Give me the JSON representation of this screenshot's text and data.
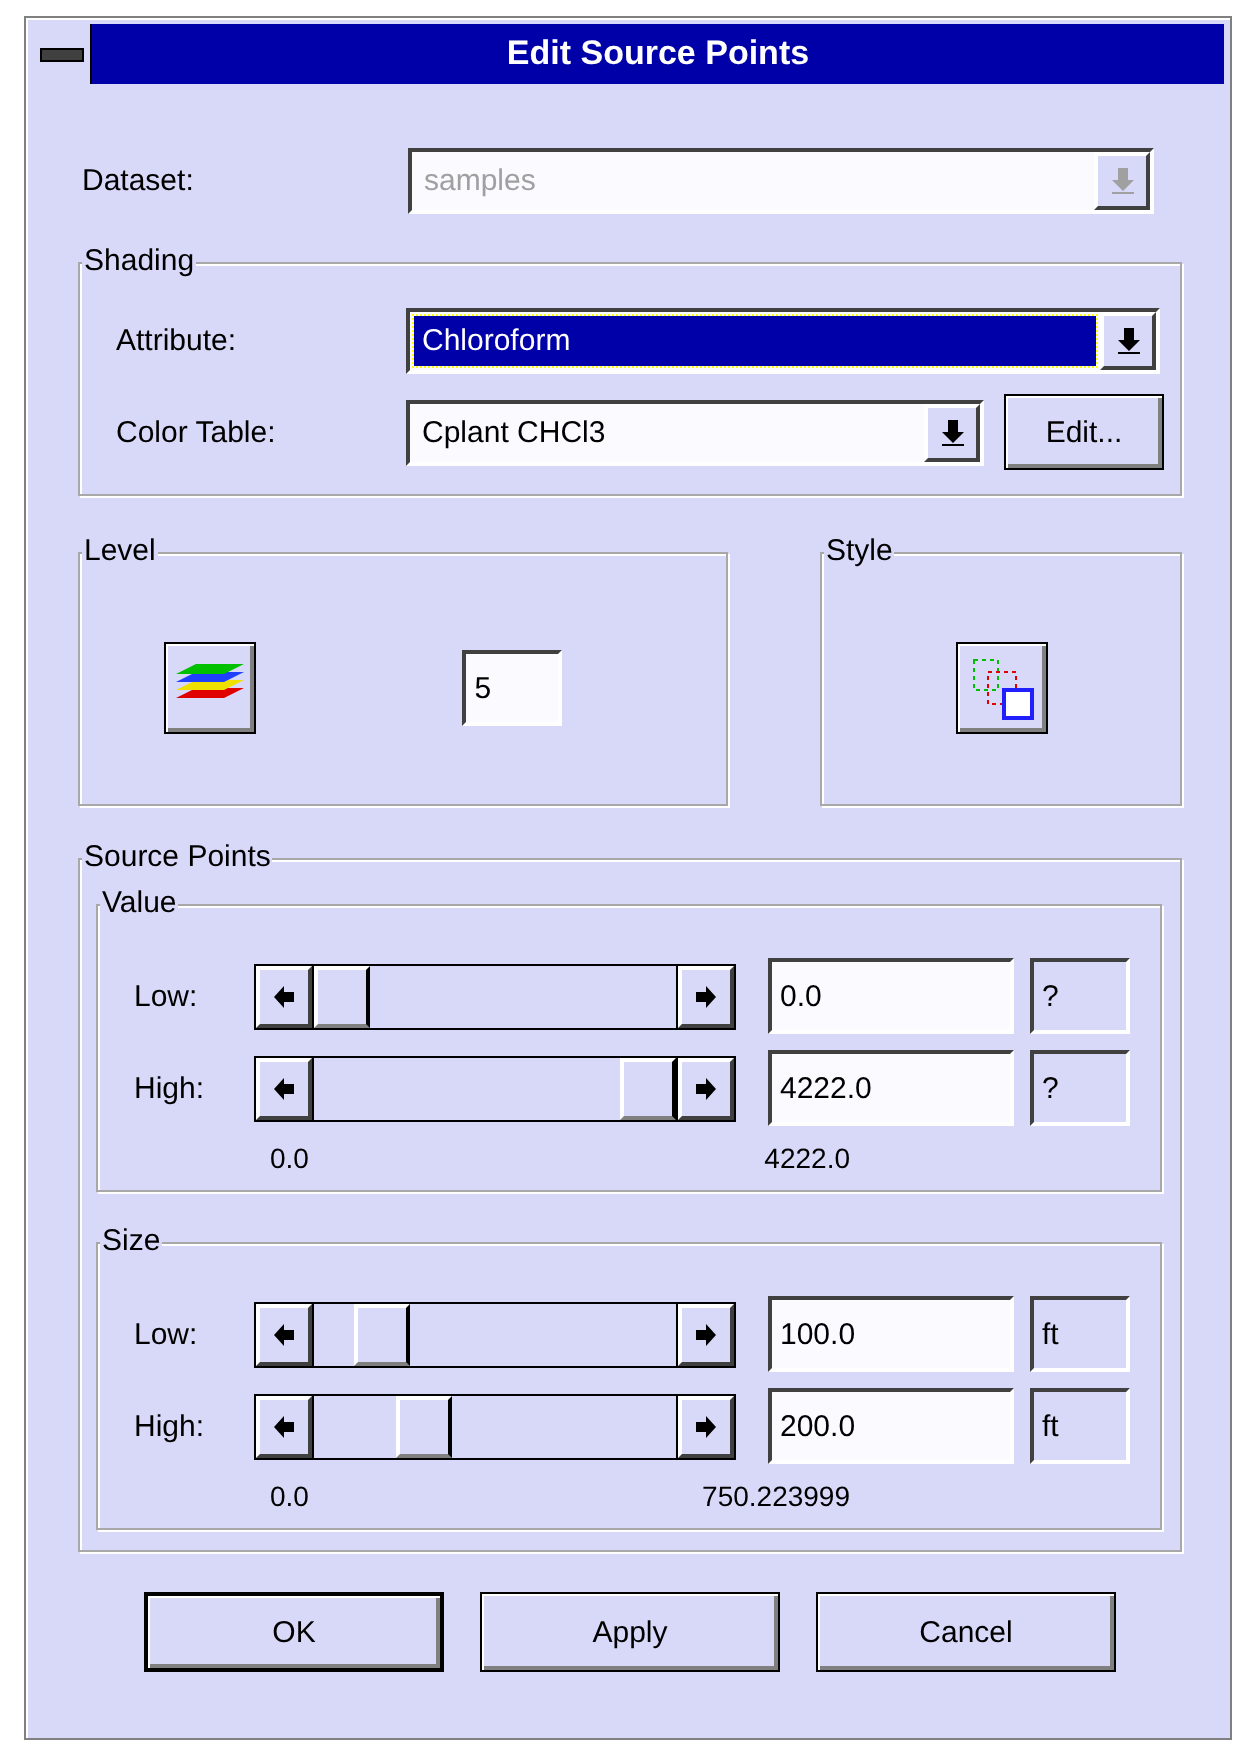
{
  "window": {
    "title": "Edit Source Points"
  },
  "dataset": {
    "label": "Dataset:",
    "value": "samples",
    "disabled": true
  },
  "shading": {
    "title": "Shading",
    "attribute": {
      "label": "Attribute:",
      "value": "Chloroform",
      "selected": true
    },
    "color_table": {
      "label": "Color Table:",
      "value": "Cplant CHCl3",
      "selected": false
    },
    "edit_button": "Edit..."
  },
  "level": {
    "title": "Level",
    "value": "5"
  },
  "style": {
    "title": "Style"
  },
  "source_points": {
    "title": "Source Points",
    "groups": [
      {
        "title": "Value",
        "min": "0.0",
        "max": "4222.0",
        "rows": [
          {
            "label": "Low:",
            "value": "0.0",
            "unit": "?"
          },
          {
            "label": "High:",
            "value": "4222.0",
            "unit": "?"
          }
        ]
      },
      {
        "title": "Size",
        "min": "0.0",
        "max": "750.223999",
        "rows": [
          {
            "label": "Low:",
            "value": "100.0",
            "unit": "ft"
          },
          {
            "label": "High:",
            "value": "200.0",
            "unit": "ft"
          }
        ]
      }
    ]
  },
  "buttons": [
    {
      "label": "OK",
      "default": true
    },
    {
      "label": "Apply",
      "default": false
    },
    {
      "label": "Cancel",
      "default": false
    }
  ]
}
